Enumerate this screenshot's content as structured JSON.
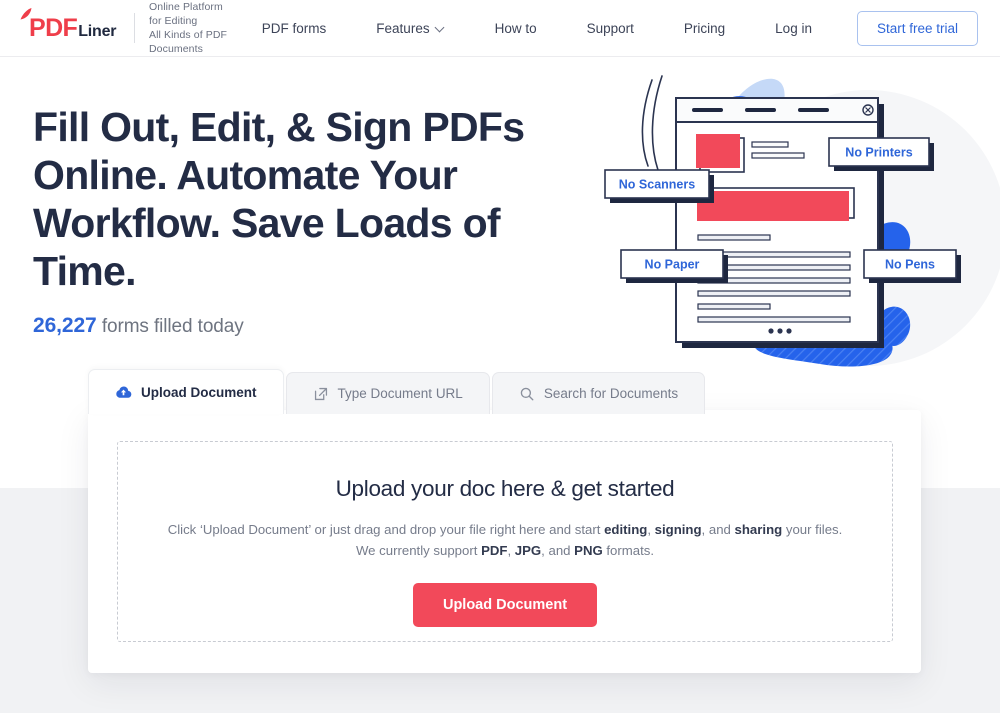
{
  "header": {
    "logo": {
      "mark": "PDF",
      "name": "Liner"
    },
    "tagline_line1": "Online Platform for Editing",
    "tagline_line2": "All Kinds of PDF Documents",
    "nav": [
      {
        "label": "PDF forms",
        "has_dropdown": false
      },
      {
        "label": "Features",
        "has_dropdown": true
      },
      {
        "label": "How to",
        "has_dropdown": false
      },
      {
        "label": "Support",
        "has_dropdown": false
      },
      {
        "label": "Pricing",
        "has_dropdown": false
      },
      {
        "label": "Log in",
        "has_dropdown": false
      }
    ],
    "cta_label": "Start free trial"
  },
  "hero": {
    "headline": "Fill Out, Edit, & Sign PDFs Online. Automate Your Workflow. Save Loads of Time.",
    "counter_value": "26,227",
    "counter_label": "forms filled today"
  },
  "illustration": {
    "labels": [
      {
        "text": "No Scanners"
      },
      {
        "text": "No Printers"
      },
      {
        "text": "No Paper"
      },
      {
        "text": "No Pens"
      }
    ],
    "close_icon": "circled-x-icon",
    "ellipsis": "•••"
  },
  "tabs": [
    {
      "label": "Upload Document",
      "icon": "cloud-upload-icon",
      "active": true
    },
    {
      "label": "Type Document URL",
      "icon": "external-link-icon",
      "active": false
    },
    {
      "label": "Search for Documents",
      "icon": "search-icon",
      "active": false
    }
  ],
  "upload_card": {
    "title": "Upload your doc here & get started",
    "description_parts": [
      {
        "text": "Click ‘Upload Document’ or just drag and drop your file right here and start ",
        "bold": false
      },
      {
        "text": "editing",
        "bold": true
      },
      {
        "text": ", ",
        "bold": false
      },
      {
        "text": "signing",
        "bold": true
      },
      {
        "text": ", and ",
        "bold": false
      },
      {
        "text": "sharing",
        "bold": true
      },
      {
        "text": " your files. We currently support ",
        "bold": false
      },
      {
        "text": "PDF",
        "bold": true
      },
      {
        "text": ", ",
        "bold": false
      },
      {
        "text": "JPG",
        "bold": true
      },
      {
        "text": ", and ",
        "bold": false
      },
      {
        "text": "PNG",
        "bold": true
      },
      {
        "text": " formats.",
        "bold": false
      }
    ],
    "button_label": "Upload Document"
  },
  "colors": {
    "brand_red": "#ef3e4a",
    "button_red": "#f2495a",
    "accent_blue": "#2f66d8",
    "illustration_blue": "#2563eb",
    "illustration_light_blue": "#c5d9f7",
    "dark_navy": "#232c45",
    "page_band_grey": "#f1f2f4"
  }
}
